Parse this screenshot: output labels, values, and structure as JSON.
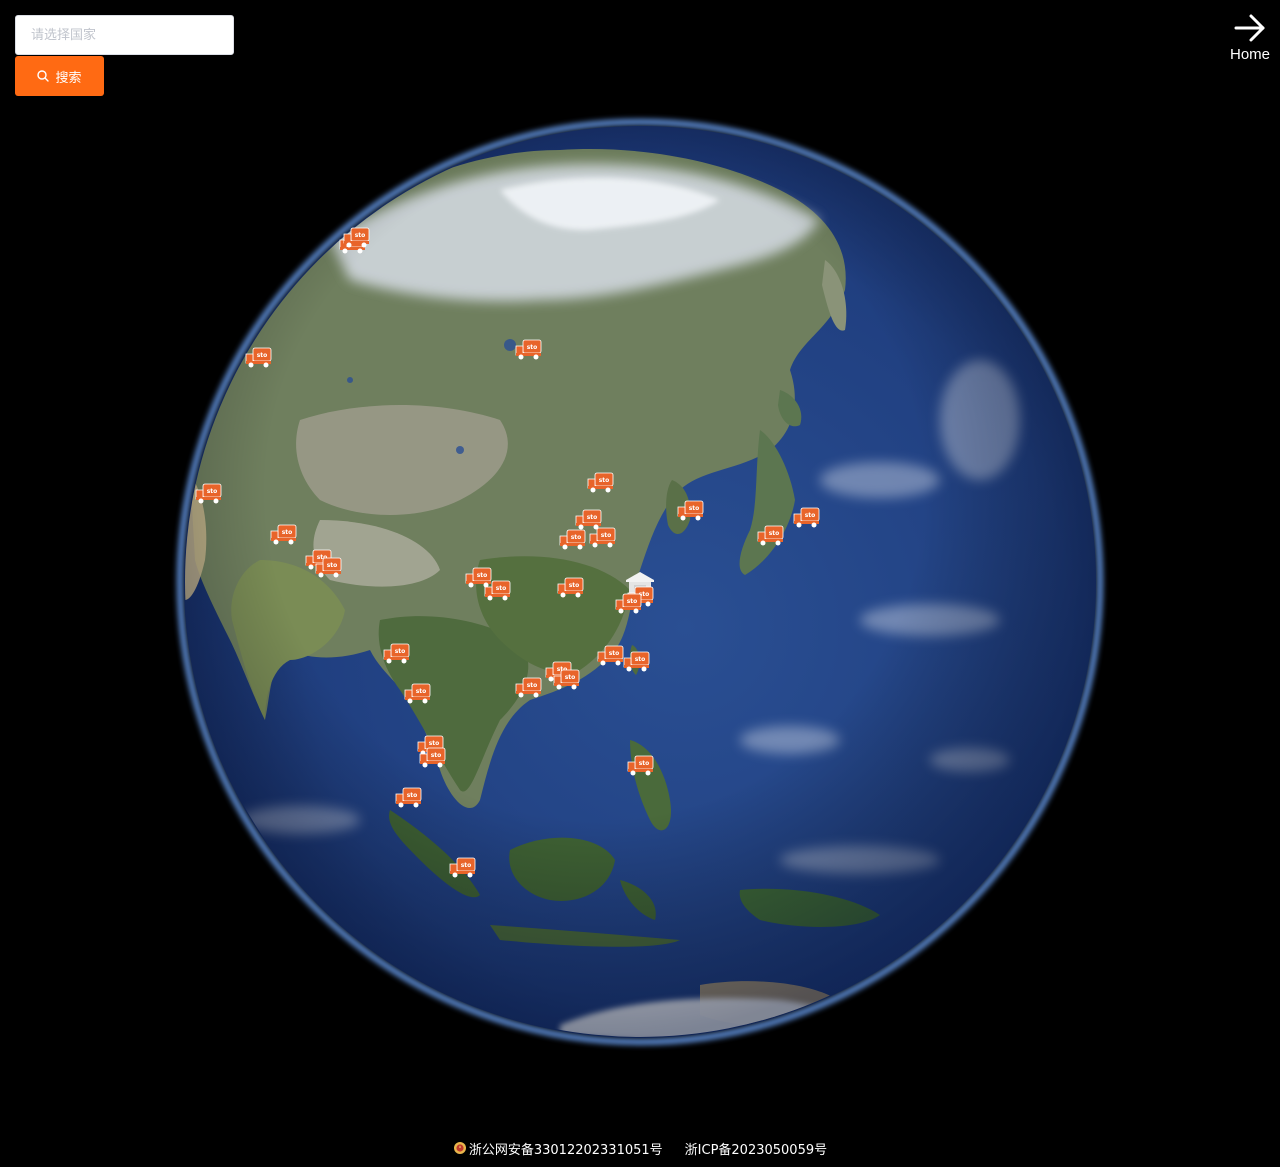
{
  "search": {
    "placeholder": "请选择国家",
    "button_label": "搜索",
    "button_icon": "search-icon"
  },
  "home": {
    "label": "Home",
    "icon": "arrow-right-icon"
  },
  "map": {
    "marker_icon": "delivery-truck-icon",
    "marker_label": "sto",
    "warehouse_icon": "warehouse-icon",
    "accent_color": "#e8642a"
  },
  "footer": {
    "police_icon": "police-badge-icon",
    "police_record": "浙公网安备33012202331051号",
    "icp_record": "浙ICP备2023050059号"
  }
}
